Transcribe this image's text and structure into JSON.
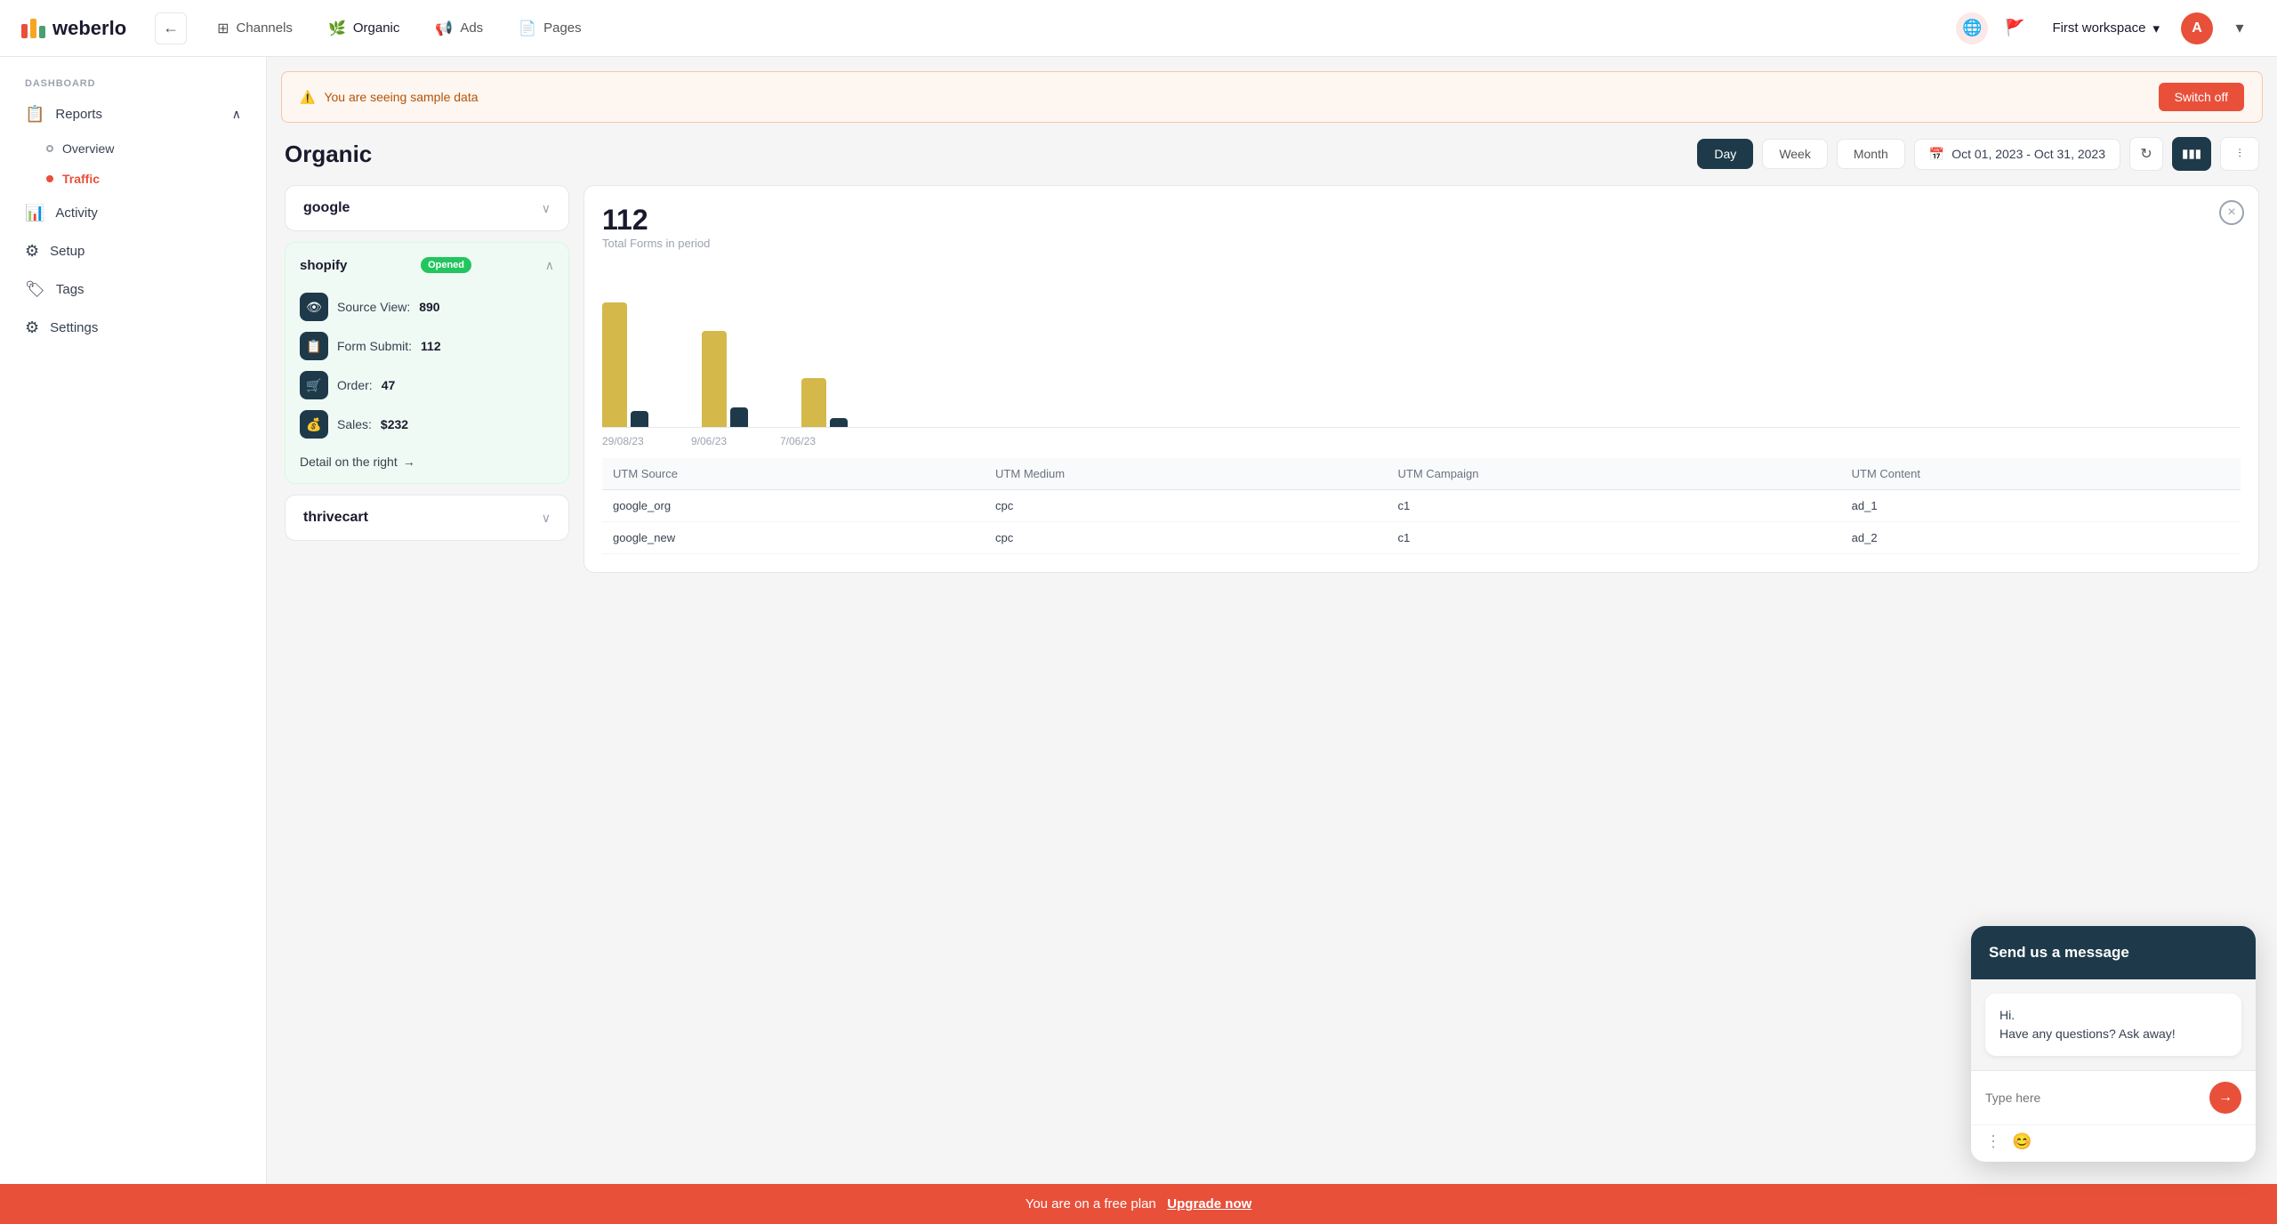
{
  "app": {
    "logo_text": "weberlo"
  },
  "topnav": {
    "back_label": "←",
    "tabs": [
      {
        "id": "channels",
        "label": "Channels",
        "icon": "⊞",
        "active": false
      },
      {
        "id": "organic",
        "label": "Organic",
        "icon": "🌿",
        "active": true
      },
      {
        "id": "ads",
        "label": "Ads",
        "icon": "📢",
        "active": false
      },
      {
        "id": "pages",
        "label": "Pages",
        "icon": "📄",
        "active": false
      }
    ],
    "workspace_label": "First workspace",
    "avatar_letter": "A"
  },
  "sidebar": {
    "section_label": "DASHBOARD",
    "items": [
      {
        "id": "reports",
        "label": "Reports",
        "icon": "📋",
        "has_arrow": true,
        "active": false
      },
      {
        "id": "overview",
        "label": "Overview",
        "sub": true,
        "active": false
      },
      {
        "id": "traffic",
        "label": "Traffic",
        "sub": true,
        "active": true
      },
      {
        "id": "activity",
        "label": "Activity",
        "icon": "📊",
        "active": false
      },
      {
        "id": "setup",
        "label": "Setup",
        "icon": "⚙",
        "active": false
      },
      {
        "id": "tags",
        "label": "Tags",
        "icon": "🏷",
        "active": false
      },
      {
        "id": "settings",
        "label": "Settings",
        "icon": "⚙",
        "active": false
      }
    ]
  },
  "sample_banner": {
    "text": "You are seeing sample data",
    "switch_off_label": "Switch off"
  },
  "page": {
    "title": "Organic",
    "period_buttons": [
      {
        "id": "day",
        "label": "Day",
        "active": true
      },
      {
        "id": "week",
        "label": "Week",
        "active": false
      },
      {
        "id": "month",
        "label": "Month",
        "active": false
      }
    ],
    "date_range": "Oct 01, 2023 - Oct 31, 2023"
  },
  "left_panel": {
    "sources": [
      {
        "id": "google",
        "name": "google",
        "expanded": false
      },
      {
        "id": "shopify",
        "name": "shopify",
        "badge": "Opened",
        "metrics": [
          {
            "id": "source_view",
            "label": "Source View:",
            "value": "890",
            "icon": "👁"
          },
          {
            "id": "form_submit",
            "label": "Form Submit:",
            "value": "112",
            "icon": "📋"
          },
          {
            "id": "order",
            "label": "Order:",
            "value": "47",
            "icon": "🛒"
          },
          {
            "id": "sales",
            "label": "Sales:",
            "value": "$232",
            "icon": "💰"
          }
        ],
        "detail_link": "Detail on the right"
      },
      {
        "id": "thrivecart",
        "name": "thrivecart",
        "expanded": false
      }
    ]
  },
  "chart": {
    "total_label": "112",
    "subtitle": "Total Forms in period",
    "close_btn": "×",
    "bars": [
      {
        "date": "29/08/23",
        "yellow_height": 140,
        "dark_height": 18
      },
      {
        "date": "9/06/23",
        "yellow_height": 110,
        "dark_height": 22
      },
      {
        "date": "7/06/23",
        "yellow_height": 55,
        "dark_height": 10
      }
    ]
  },
  "table": {
    "columns": [
      "UTM Source",
      "UTM Medium",
      "UTM Campaign",
      "UTM Content"
    ],
    "rows": [
      {
        "source": "google_org",
        "medium": "cpc",
        "campaign": "c1",
        "content": "ad_1"
      },
      {
        "source": "google_new",
        "medium": "cpc",
        "campaign": "c1",
        "content": "ad_2"
      }
    ]
  },
  "bottom_banner": {
    "text": "You are on a free plan",
    "link_text": "Upgrade now"
  },
  "chat": {
    "header": "Send us a message",
    "message": "Hi.\nHave any questions? Ask away!",
    "input_placeholder": "Type here",
    "send_icon": "→"
  }
}
